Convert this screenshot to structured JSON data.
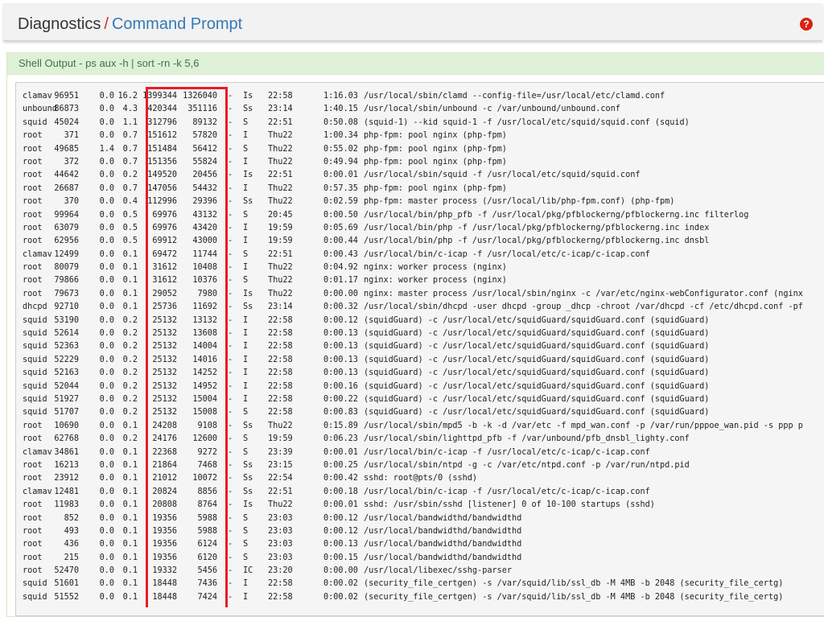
{
  "header": {
    "crumb_section": "Diagnostics",
    "crumb_separator": "/",
    "crumb_page": "Command Prompt",
    "help_icon": "?"
  },
  "panel": {
    "title": "Shell Output - ps aux -h | sort -rn -k 5,6"
  },
  "colors": {
    "panel_heading_bg": "#dff0d8",
    "panel_heading_text": "#3c763d",
    "link": "#337ab7",
    "separator": "#c9302c",
    "highlight_box": "#e81c24"
  },
  "rows": [
    [
      "clamav",
      "96951",
      "0.0",
      "16.2",
      "1399344",
      "1326040",
      "-",
      "Is",
      "22:58",
      "1:16.03",
      "/usr/local/sbin/clamd --config-file=/usr/local/etc/clamd.conf"
    ],
    [
      "unbound",
      "86873",
      "0.0",
      "4.3",
      "420344",
      "351116",
      "-",
      "Ss",
      "23:14",
      "1:40.15",
      "/usr/local/sbin/unbound -c /var/unbound/unbound.conf"
    ],
    [
      "squid",
      "45024",
      "0.0",
      "1.1",
      "312796",
      "89132",
      "-",
      "S",
      "22:51",
      "0:50.08",
      "(squid-1) --kid squid-1 -f /usr/local/etc/squid/squid.conf (squid)"
    ],
    [
      "root",
      "371",
      "0.0",
      "0.7",
      "151612",
      "57820",
      "-",
      "I",
      "Thu22",
      "1:00.34",
      "php-fpm: pool nginx (php-fpm)"
    ],
    [
      "root",
      "49685",
      "1.4",
      "0.7",
      "151484",
      "56412",
      "-",
      "S",
      "Thu22",
      "0:55.02",
      "php-fpm: pool nginx (php-fpm)"
    ],
    [
      "root",
      "372",
      "0.0",
      "0.7",
      "151356",
      "55824",
      "-",
      "I",
      "Thu22",
      "0:49.94",
      "php-fpm: pool nginx (php-fpm)"
    ],
    [
      "root",
      "44642",
      "0.0",
      "0.2",
      "149520",
      "20456",
      "-",
      "Is",
      "22:51",
      "0:00.01",
      "/usr/local/sbin/squid -f /usr/local/etc/squid/squid.conf"
    ],
    [
      "root",
      "26687",
      "0.0",
      "0.7",
      "147056",
      "54432",
      "-",
      "I",
      "Thu22",
      "0:57.35",
      "php-fpm: pool nginx (php-fpm)"
    ],
    [
      "root",
      "370",
      "0.0",
      "0.4",
      "112996",
      "29396",
      "-",
      "Ss",
      "Thu22",
      "0:02.59",
      "php-fpm: master process (/usr/local/lib/php-fpm.conf) (php-fpm)"
    ],
    [
      "root",
      "99964",
      "0.0",
      "0.5",
      "69976",
      "43132",
      "-",
      "S",
      "20:45",
      "0:00.50",
      "/usr/local/bin/php_pfb -f /usr/local/pkg/pfblockerng/pfblockerng.inc filterlog"
    ],
    [
      "root",
      "63079",
      "0.0",
      "0.5",
      "69976",
      "43420",
      "-",
      "I",
      "19:59",
      "0:05.69",
      "/usr/local/bin/php -f /usr/local/pkg/pfblockerng/pfblockerng.inc index"
    ],
    [
      "root",
      "62956",
      "0.0",
      "0.5",
      "69912",
      "43000",
      "-",
      "I",
      "19:59",
      "0:00.44",
      "/usr/local/bin/php -f /usr/local/pkg/pfblockerng/pfblockerng.inc dnsbl"
    ],
    [
      "clamav",
      "12499",
      "0.0",
      "0.1",
      "69472",
      "11744",
      "-",
      "S",
      "22:51",
      "0:00.43",
      "/usr/local/bin/c-icap -f /usr/local/etc/c-icap/c-icap.conf"
    ],
    [
      "root",
      "80079",
      "0.0",
      "0.1",
      "31612",
      "10408",
      "-",
      "I",
      "Thu22",
      "0:04.92",
      "nginx: worker process (nginx)"
    ],
    [
      "root",
      "79866",
      "0.0",
      "0.1",
      "31612",
      "10376",
      "-",
      "S",
      "Thu22",
      "0:01.17",
      "nginx: worker process (nginx)"
    ],
    [
      "root",
      "79673",
      "0.0",
      "0.1",
      "29052",
      "7980",
      "-",
      "Is",
      "Thu22",
      "0:00.00",
      "nginx: master process /usr/local/sbin/nginx -c /var/etc/nginx-webConfigurator.conf (nginx"
    ],
    [
      "dhcpd",
      "92710",
      "0.0",
      "0.1",
      "25736",
      "11692",
      "-",
      "Ss",
      "23:14",
      "0:00.32",
      "/usr/local/sbin/dhcpd -user dhcpd -group _dhcp -chroot /var/dhcpd -cf /etc/dhcpd.conf -pf"
    ],
    [
      "squid",
      "53190",
      "0.0",
      "0.2",
      "25132",
      "13132",
      "-",
      "I",
      "22:58",
      "0:00.12",
      "(squidGuard) -c /usr/local/etc/squidGuard/squidGuard.conf (squidGuard)"
    ],
    [
      "squid",
      "52614",
      "0.0",
      "0.2",
      "25132",
      "13608",
      "-",
      "I",
      "22:58",
      "0:00.13",
      "(squidGuard) -c /usr/local/etc/squidGuard/squidGuard.conf (squidGuard)"
    ],
    [
      "squid",
      "52363",
      "0.0",
      "0.2",
      "25132",
      "14004",
      "-",
      "I",
      "22:58",
      "0:00.13",
      "(squidGuard) -c /usr/local/etc/squidGuard/squidGuard.conf (squidGuard)"
    ],
    [
      "squid",
      "52229",
      "0.0",
      "0.2",
      "25132",
      "14016",
      "-",
      "I",
      "22:58",
      "0:00.13",
      "(squidGuard) -c /usr/local/etc/squidGuard/squidGuard.conf (squidGuard)"
    ],
    [
      "squid",
      "52163",
      "0.0",
      "0.2",
      "25132",
      "14252",
      "-",
      "I",
      "22:58",
      "0:00.13",
      "(squidGuard) -c /usr/local/etc/squidGuard/squidGuard.conf (squidGuard)"
    ],
    [
      "squid",
      "52044",
      "0.0",
      "0.2",
      "25132",
      "14952",
      "-",
      "I",
      "22:58",
      "0:00.16",
      "(squidGuard) -c /usr/local/etc/squidGuard/squidGuard.conf (squidGuard)"
    ],
    [
      "squid",
      "51927",
      "0.0",
      "0.2",
      "25132",
      "15004",
      "-",
      "I",
      "22:58",
      "0:00.22",
      "(squidGuard) -c /usr/local/etc/squidGuard/squidGuard.conf (squidGuard)"
    ],
    [
      "squid",
      "51707",
      "0.0",
      "0.2",
      "25132",
      "15008",
      "-",
      "S",
      "22:58",
      "0:00.83",
      "(squidGuard) -c /usr/local/etc/squidGuard/squidGuard.conf (squidGuard)"
    ],
    [
      "root",
      "10690",
      "0.0",
      "0.1",
      "24208",
      "9108",
      "-",
      "Ss",
      "Thu22",
      "0:15.89",
      "/usr/local/sbin/mpd5 -b -k -d /var/etc -f mpd_wan.conf -p /var/run/pppoe_wan.pid -s ppp p"
    ],
    [
      "root",
      "62768",
      "0.0",
      "0.2",
      "24176",
      "12600",
      "-",
      "S",
      "19:59",
      "0:06.23",
      "/usr/local/sbin/lighttpd_pfb -f /var/unbound/pfb_dnsbl_lighty.conf"
    ],
    [
      "clamav",
      "34861",
      "0.0",
      "0.1",
      "22368",
      "9272",
      "-",
      "S",
      "23:39",
      "0:00.01",
      "/usr/local/bin/c-icap -f /usr/local/etc/c-icap/c-icap.conf"
    ],
    [
      "root",
      "16213",
      "0.0",
      "0.1",
      "21864",
      "7468",
      "-",
      "Ss",
      "23:15",
      "0:00.25",
      "/usr/local/sbin/ntpd -g -c /var/etc/ntpd.conf -p /var/run/ntpd.pid"
    ],
    [
      "root",
      "23912",
      "0.0",
      "0.1",
      "21012",
      "10072",
      "-",
      "Ss",
      "22:54",
      "0:00.42",
      "sshd: root@pts/0 (sshd)"
    ],
    [
      "clamav",
      "12481",
      "0.0",
      "0.1",
      "20824",
      "8856",
      "-",
      "Ss",
      "22:51",
      "0:00.18",
      "/usr/local/bin/c-icap -f /usr/local/etc/c-icap/c-icap.conf"
    ],
    [
      "root",
      "11983",
      "0.0",
      "0.1",
      "20808",
      "8764",
      "-",
      "Is",
      "Thu22",
      "0:00.01",
      "sshd: /usr/sbin/sshd [listener] 0 of 10-100 startups (sshd)"
    ],
    [
      "root",
      "852",
      "0.0",
      "0.1",
      "19356",
      "5988",
      "-",
      "S",
      "23:03",
      "0:00.12",
      "/usr/local/bandwidthd/bandwidthd"
    ],
    [
      "root",
      "493",
      "0.0",
      "0.1",
      "19356",
      "5988",
      "-",
      "S",
      "23:03",
      "0:00.12",
      "/usr/local/bandwidthd/bandwidthd"
    ],
    [
      "root",
      "436",
      "0.0",
      "0.1",
      "19356",
      "6124",
      "-",
      "S",
      "23:03",
      "0:00.13",
      "/usr/local/bandwidthd/bandwidthd"
    ],
    [
      "root",
      "215",
      "0.0",
      "0.1",
      "19356",
      "6120",
      "-",
      "S",
      "23:03",
      "0:00.15",
      "/usr/local/bandwidthd/bandwidthd"
    ],
    [
      "root",
      "52470",
      "0.0",
      "0.1",
      "19332",
      "5456",
      "-",
      "IC",
      "23:20",
      "0:00.00",
      "/usr/local/libexec/sshg-parser"
    ],
    [
      "squid",
      "51601",
      "0.0",
      "0.1",
      "18448",
      "7436",
      "-",
      "I",
      "22:58",
      "0:00.02",
      "(security_file_certgen) -s /var/squid/lib/ssl_db -M 4MB -b 2048 (security_file_certg)"
    ],
    [
      "squid",
      "51552",
      "0.0",
      "0.1",
      "18448",
      "7424",
      "-",
      "I",
      "22:58",
      "0:00.02",
      "(security_file_certgen) -s /var/squid/lib/ssl_db -M 4MB -b 2048 (security_file_certg)"
    ]
  ]
}
